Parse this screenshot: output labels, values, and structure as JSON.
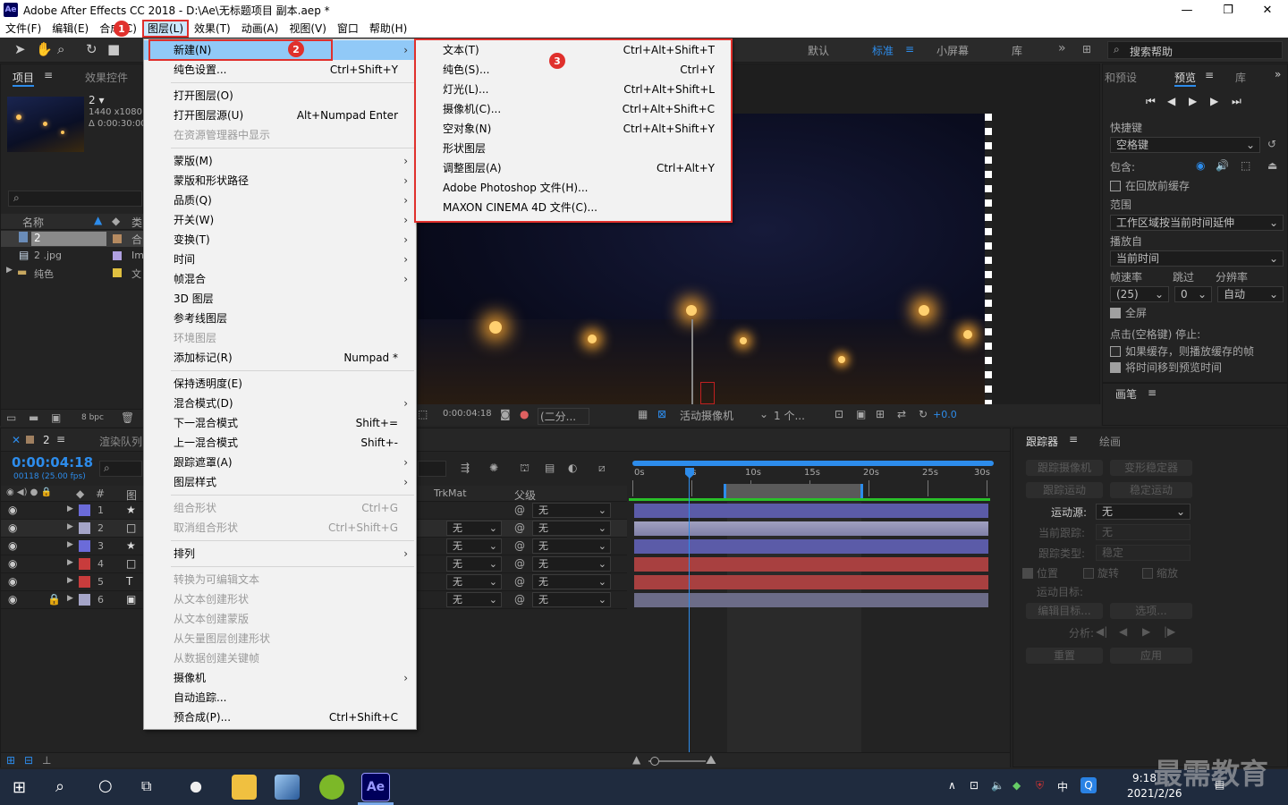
{
  "window": {
    "app_icon": "Ae",
    "title": "Adobe After Effects CC 2018 - D:\\Ae\\无标题项目 副本.aep *",
    "min": "—",
    "max": "❐",
    "close": "✕"
  },
  "menubar": [
    "文件(F)",
    "编辑(E)",
    "合成(C)",
    "图层(L)",
    "效果(T)",
    "动画(A)",
    "视图(V)",
    "窗口",
    "帮助(H)"
  ],
  "badges": [
    "1",
    "2",
    "3"
  ],
  "workspaces": {
    "default": "默认",
    "standard": "标准",
    "small": "小屏幕",
    "library": "库",
    "more": "»"
  },
  "search_help": {
    "placeholder": "搜索帮助"
  },
  "project": {
    "tab_project": "项目",
    "tab_effects": "效果控件",
    "thumb_name": "2 ▾",
    "thumb_res": "1440 x1080 (",
    "thumb_dur": "Δ 0:00:30:00",
    "col_name": "名称",
    "col_type": "类",
    "items": [
      {
        "name": "2",
        "type": "合"
      },
      {
        "name": "2 .jpg",
        "type": "Im"
      },
      {
        "name": "纯色",
        "type": "文"
      }
    ],
    "bpc": "8 bpc"
  },
  "layer_menu": {
    "items": [
      {
        "label": "新建(N)",
        "shortcut": "",
        "arrow": true,
        "dis": false,
        "hl": true
      },
      {
        "label": "纯色设置...",
        "shortcut": "Ctrl+Shift+Y",
        "arrow": false,
        "dis": false
      },
      {
        "sep": true
      },
      {
        "label": "打开图层(O)",
        "shortcut": "",
        "arrow": false,
        "dis": false
      },
      {
        "label": "打开图层源(U)",
        "shortcut": "Alt+Numpad Enter",
        "arrow": false,
        "dis": false
      },
      {
        "label": "在资源管理器中显示",
        "shortcut": "",
        "arrow": false,
        "dis": true
      },
      {
        "sep": true
      },
      {
        "label": "蒙版(M)",
        "shortcut": "",
        "arrow": true,
        "dis": false
      },
      {
        "label": "蒙版和形状路径",
        "shortcut": "",
        "arrow": true,
        "dis": false
      },
      {
        "label": "品质(Q)",
        "shortcut": "",
        "arrow": true,
        "dis": false
      },
      {
        "label": "开关(W)",
        "shortcut": "",
        "arrow": true,
        "dis": false
      },
      {
        "label": "变换(T)",
        "shortcut": "",
        "arrow": true,
        "dis": false
      },
      {
        "label": "时间",
        "shortcut": "",
        "arrow": true,
        "dis": false
      },
      {
        "label": "帧混合",
        "shortcut": "",
        "arrow": true,
        "dis": false
      },
      {
        "label": "3D 图层",
        "shortcut": "",
        "arrow": false,
        "dis": false
      },
      {
        "label": "参考线图层",
        "shortcut": "",
        "arrow": false,
        "dis": false
      },
      {
        "label": "环境图层",
        "shortcut": "",
        "arrow": false,
        "dis": true
      },
      {
        "label": "添加标记(R)",
        "shortcut": "Numpad *",
        "arrow": false,
        "dis": false
      },
      {
        "sep": true
      },
      {
        "label": "保持透明度(E)",
        "shortcut": "",
        "arrow": false,
        "dis": false
      },
      {
        "label": "混合模式(D)",
        "shortcut": "",
        "arrow": true,
        "dis": false
      },
      {
        "label": "下一混合模式",
        "shortcut": "Shift+=",
        "arrow": false,
        "dis": false
      },
      {
        "label": "上一混合模式",
        "shortcut": "Shift+-",
        "arrow": false,
        "dis": false
      },
      {
        "label": "跟踪遮罩(A)",
        "shortcut": "",
        "arrow": true,
        "dis": false
      },
      {
        "label": "图层样式",
        "shortcut": "",
        "arrow": true,
        "dis": false
      },
      {
        "sep": true
      },
      {
        "label": "组合形状",
        "shortcut": "Ctrl+G",
        "arrow": false,
        "dis": true
      },
      {
        "label": "取消组合形状",
        "shortcut": "Ctrl+Shift+G",
        "arrow": false,
        "dis": true
      },
      {
        "sep": true
      },
      {
        "label": "排列",
        "shortcut": "",
        "arrow": true,
        "dis": false
      },
      {
        "sep": true
      },
      {
        "label": "转换为可编辑文本",
        "shortcut": "",
        "arrow": false,
        "dis": true
      },
      {
        "label": "从文本创建形状",
        "shortcut": "",
        "arrow": false,
        "dis": true
      },
      {
        "label": "从文本创建蒙版",
        "shortcut": "",
        "arrow": false,
        "dis": true
      },
      {
        "label": "从矢量图层创建形状",
        "shortcut": "",
        "arrow": false,
        "dis": true
      },
      {
        "label": "从数据创建关键帧",
        "shortcut": "",
        "arrow": false,
        "dis": true
      },
      {
        "label": "摄像机",
        "shortcut": "",
        "arrow": true,
        "dis": false
      },
      {
        "label": "自动追踪...",
        "shortcut": "",
        "arrow": false,
        "dis": false
      },
      {
        "label": "预合成(P)...",
        "shortcut": "Ctrl+Shift+C",
        "arrow": false,
        "dis": false
      }
    ]
  },
  "new_submenu": [
    {
      "label": "文本(T)",
      "shortcut": "Ctrl+Alt+Shift+T"
    },
    {
      "label": "纯色(S)...",
      "shortcut": "Ctrl+Y"
    },
    {
      "label": "灯光(L)...",
      "shortcut": "Ctrl+Alt+Shift+L"
    },
    {
      "label": "摄像机(C)...",
      "shortcut": "Ctrl+Alt+Shift+C"
    },
    {
      "label": "空对象(N)",
      "shortcut": "Ctrl+Alt+Shift+Y"
    },
    {
      "label": "形状图层",
      "shortcut": ""
    },
    {
      "label": "调整图层(A)",
      "shortcut": "Ctrl+Alt+Y"
    },
    {
      "label": "Adobe Photoshop 文件(H)...",
      "shortcut": ""
    },
    {
      "label": "MAXON CINEMA 4D 文件(C)...",
      "shortcut": ""
    }
  ],
  "viewer_bar": {
    "timecode": "0:00:04:18",
    "resolution": "(二分...",
    "camera": "活动摄像机",
    "views": "1 个...",
    "exposure": "+0.0"
  },
  "timeline": {
    "tab_comp": "2",
    "tab_render": "渲染队列",
    "timecode": "0:00:04:18",
    "frames": "00118 (25.00 fps)",
    "col_source": "图",
    "col_num": "#",
    "col_trkmat": "TrkMat",
    "col_parent": "父级",
    "ticks": [
      "0s",
      "5s",
      "10s",
      "15s",
      "20s",
      "25s",
      "30s"
    ],
    "layers": [
      {
        "num": "1",
        "color": "#6b6bd9",
        "icon": "★",
        "trk": "",
        "parent": "无",
        "bar": "#5b5ba8"
      },
      {
        "num": "2",
        "color": "#a5a5c8",
        "icon": "□",
        "trk": "无",
        "parent": "无",
        "bar": "#8c8cb4"
      },
      {
        "num": "3",
        "color": "#6b6bd9",
        "icon": "★",
        "trk": "无",
        "parent": "无",
        "bar": "#5b5ba8"
      },
      {
        "num": "4",
        "color": "#c83c3c",
        "icon": "□",
        "trk": "无",
        "parent": "无",
        "bar": "#a84040"
      },
      {
        "num": "5",
        "color": "#c83c3c",
        "icon": "T",
        "trk": "无",
        "parent": "无",
        "bar": "#a84040"
      },
      {
        "num": "6",
        "color": "#a5a5c8",
        "icon": "▣",
        "trk": "无",
        "parent": "无",
        "bar": "#6c6c88"
      }
    ]
  },
  "preview": {
    "tab_presets": "和预设",
    "tab_preview": "预览",
    "tab_library": "库",
    "shortcut_label": "快捷键",
    "shortcut_value": "空格键",
    "include_label": "包含:",
    "cache_before": "在回放前缓存",
    "range_label": "范围",
    "range_value": "工作区域按当前时间延伸",
    "play_from_label": "播放自",
    "play_from_value": "当前时间",
    "fps_label": "帧速率",
    "skip_label": "跳过",
    "res_label": "分辨率",
    "fps_value": "(25)",
    "skip_value": "0",
    "res_value": "自动",
    "fullscreen": "全屏",
    "stop_label": "点击(空格键) 停止:",
    "opt1": "如果缓存，则播放缓存的帧",
    "opt2": "将时间移到预览时间",
    "brush_tab": "画笔"
  },
  "tracker": {
    "tab_tracker": "跟踪器",
    "tab_paint": "绘画",
    "track_camera": "跟踪摄像机",
    "warp_stab": "变形稳定器",
    "track_motion": "跟踪运动",
    "stab_motion": "稳定运动",
    "motion_source_label": "运动源:",
    "motion_source_value": "无",
    "current_track_label": "当前跟踪:",
    "current_track_value": "无",
    "track_type_label": "跟踪类型:",
    "track_type_value": "稳定",
    "pos": "位置",
    "rot": "旋转",
    "scale": "缩放",
    "target_label": "运动目标:",
    "edit_target": "编辑目标...",
    "options": "选项...",
    "analyze_label": "分析:",
    "reset": "重置",
    "apply": "应用"
  },
  "taskbar": {
    "time": "9:18",
    "date": "2021/2/26",
    "ime": "中",
    "ae": "Ae"
  },
  "watermark": "最需教育"
}
